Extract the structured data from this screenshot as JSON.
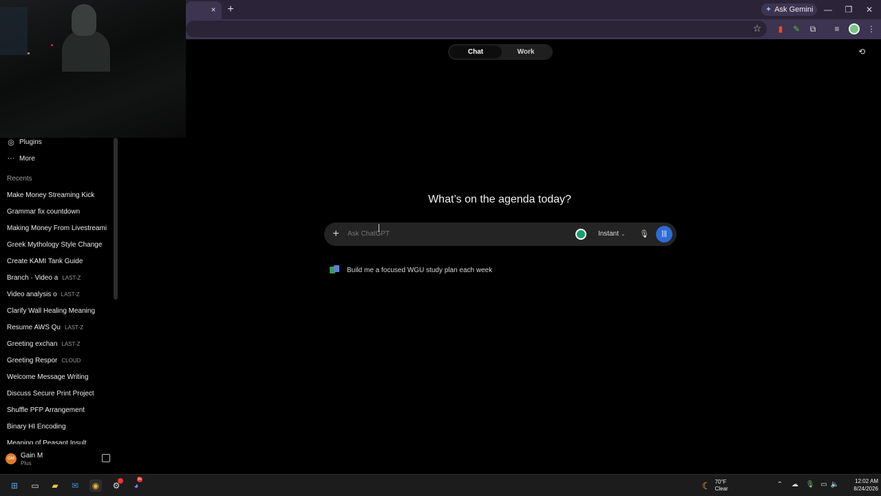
{
  "browser": {
    "tab_close": "×",
    "new_tab": "+",
    "ask_gemini": "Ask Gemini"
  },
  "sidebar": {
    "items": [
      {
        "label": "Plugins",
        "icon": "plugins-icon"
      },
      {
        "label": "More",
        "icon": "more-icon"
      }
    ],
    "recents_heading": "Recents",
    "recents": [
      {
        "title": "Make Money Streaming Kick",
        "tag": ""
      },
      {
        "title": "Grammar fix countdown",
        "tag": ""
      },
      {
        "title": "Making Money From Livestreamin",
        "tag": ""
      },
      {
        "title": "Greek Mythology Style Change",
        "tag": ""
      },
      {
        "title": "Create KAMI Tank Guide",
        "tag": ""
      },
      {
        "title": "Branch · Video a",
        "tag": "LAST-Z"
      },
      {
        "title": "Video analysis o",
        "tag": "LAST-Z"
      },
      {
        "title": "Clarify Wall Healing Meaning",
        "tag": ""
      },
      {
        "title": "Resume AWS Qu",
        "tag": "LAST-Z"
      },
      {
        "title": "Greeting exchan",
        "tag": "LAST-Z"
      },
      {
        "title": "Greeting Respor",
        "tag": "CLOUD"
      },
      {
        "title": "Welcome Message Writing",
        "tag": ""
      },
      {
        "title": "Discuss Secure Print Project",
        "tag": ""
      },
      {
        "title": "Shuffle PFP Arrangement",
        "tag": ""
      },
      {
        "title": "Binary HI Encoding",
        "tag": ""
      },
      {
        "title": "Meaning of Peasant Insult",
        "tag": ""
      }
    ],
    "user": {
      "initials": "GM",
      "name": "Gain M",
      "plan": "Plus"
    }
  },
  "main": {
    "mode_chat": "Chat",
    "mode_work": "Work",
    "headline": "What’s on the agenda today?",
    "composer": {
      "placeholder": "Ask ChatGPT",
      "model": "Instant"
    },
    "suggestion": "Build me a focused WGU study plan each week"
  },
  "taskbar": {
    "weather_temp": "70°F",
    "weather_cond": "Clear",
    "time": "12:02 AM",
    "date": "8/24/2026",
    "badge_count": "9+"
  },
  "colors": {
    "accent_blue": "#2f6ad6",
    "user_avatar": "#e07b2a",
    "grammarly_green": "#15a06a"
  }
}
